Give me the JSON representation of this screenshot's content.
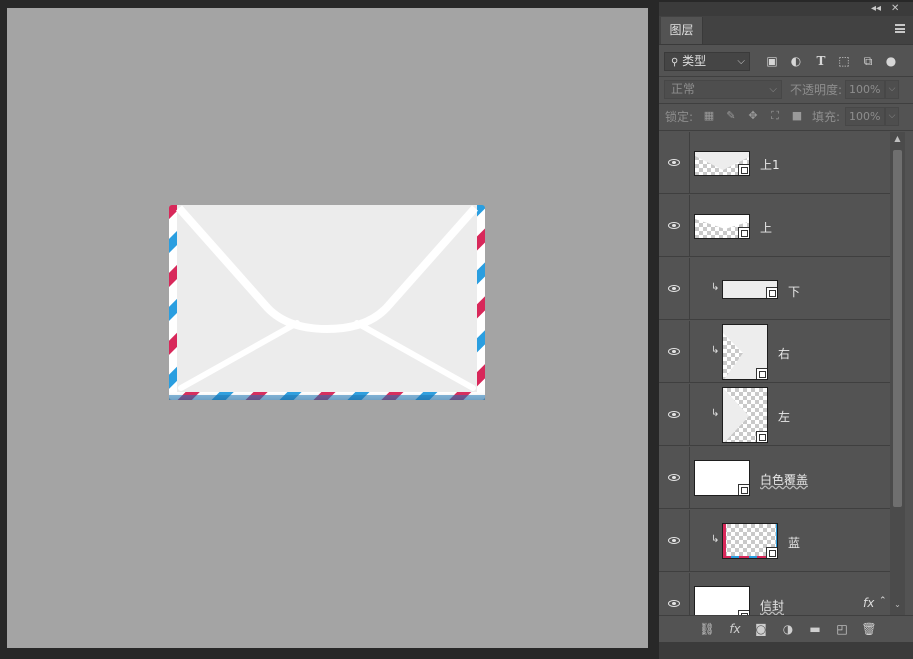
{
  "panel": {
    "tab_label": "图层",
    "collapse_glyph": "◂◂",
    "close_glyph": "✕",
    "filter": {
      "selected": "类型"
    },
    "blend_mode": "正常",
    "opacity_label": "不透明度:",
    "opacity_value": "100%",
    "lock_label": "锁定:",
    "fill_label": "填充:",
    "fill_value": "100%"
  },
  "layers": [
    {
      "name": "上1",
      "type": "smart-object",
      "clipped": false,
      "visible": true
    },
    {
      "name": "上",
      "type": "smart-object",
      "clipped": false,
      "visible": true
    },
    {
      "name": "下",
      "type": "smart-object",
      "clipped": true,
      "visible": true
    },
    {
      "name": "右",
      "type": "smart-object",
      "clipped": true,
      "visible": true
    },
    {
      "name": "左",
      "type": "smart-object",
      "clipped": true,
      "visible": true
    },
    {
      "name": "白色覆盖",
      "type": "smart-object",
      "clipped": false,
      "visible": true
    },
    {
      "name": "蓝",
      "type": "smart-object",
      "clipped": true,
      "visible": true
    },
    {
      "name": "信封",
      "type": "smart-object",
      "clipped": false,
      "visible": true,
      "fx": "fx"
    }
  ],
  "colors": {
    "canvas_bg": "#a4a4a4",
    "panel_bg": "#535353",
    "stripe_red": "#d8285a",
    "stripe_blue": "#2a9ee0",
    "envelope_face": "#ececec"
  },
  "icons": {
    "filter": [
      "search-icon",
      "image-filter-icon",
      "adjustment-filter-icon",
      "type-filter-icon",
      "shape-filter-icon",
      "smart-object-filter-icon"
    ],
    "lock": [
      "lock-transparent-icon",
      "lock-image-icon",
      "lock-position-icon",
      "lock-artboard-icon",
      "lock-all-icon"
    ],
    "bottom": [
      "link-icon",
      "fx-icon",
      "mask-icon",
      "adjustment-icon",
      "folder-icon",
      "new-layer-icon",
      "trash-icon"
    ]
  }
}
